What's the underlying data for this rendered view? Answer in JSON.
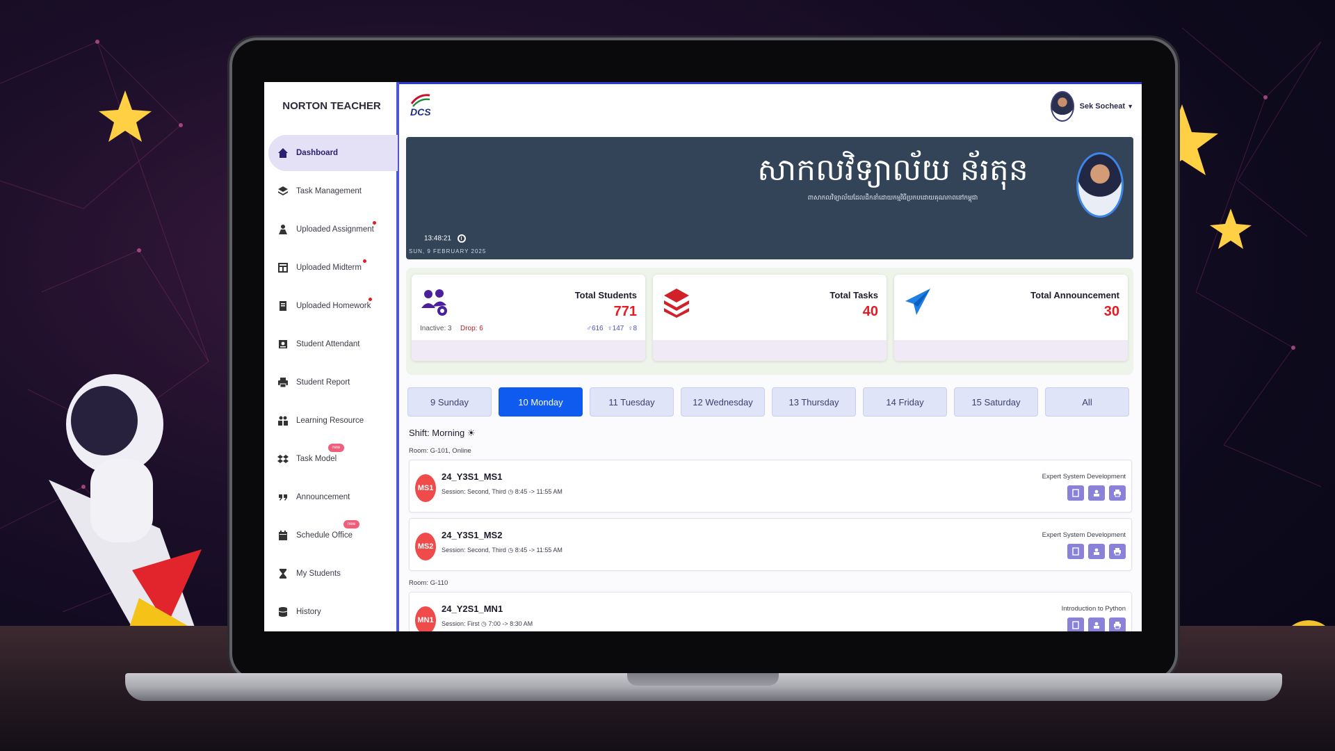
{
  "sidebar": {
    "brand": "NORTON TEACHER",
    "items": [
      {
        "label": "Dashboard"
      },
      {
        "label": "Task Management"
      },
      {
        "label": "Uploaded Assignment"
      },
      {
        "label": "Uploaded Midterm"
      },
      {
        "label": "Uploaded Homework"
      },
      {
        "label": "Student Attendant"
      },
      {
        "label": "Student Report"
      },
      {
        "label": "Learning Resource"
      },
      {
        "label": "Task Model"
      },
      {
        "label": "Announcement"
      },
      {
        "label": "Schedule Office"
      },
      {
        "label": "My Students"
      },
      {
        "label": "History"
      }
    ],
    "new_badge": "new"
  },
  "topbar": {
    "logo_text": "DCS",
    "user_name": "Sek Socheat"
  },
  "banner": {
    "title": "សាកលវិទ្យាល័យ ន័រតុន",
    "subtitle": "ពាសាកលវិទ្យាល័យដែលដឹកនាំដោយកម្មវិធីប្រកបដោយគុណភាពនៅកម្ពុជា",
    "time": "13:48:21",
    "date": "SUN, 9 FEBRUARY 2025"
  },
  "stats": {
    "students": {
      "label": "Total Students",
      "value": "771",
      "inactive": "Inactive: 3",
      "drop": "Drop: 6",
      "male": "♂616",
      "female": "♀147",
      "other": "♀8"
    },
    "tasks": {
      "label": "Total Tasks",
      "value": "40"
    },
    "announcements": {
      "label": "Total Announcement",
      "value": "30"
    }
  },
  "days": [
    {
      "label": "9 Sunday"
    },
    {
      "label": "10 Monday"
    },
    {
      "label": "11 Tuesday"
    },
    {
      "label": "12 Wednesday"
    },
    {
      "label": "13 Thursday"
    },
    {
      "label": "14 Friday"
    },
    {
      "label": "15 Saturday"
    },
    {
      "label": "All"
    }
  ],
  "schedule": {
    "shift": "Shift: Morning ☀",
    "rooms": [
      {
        "room": "Room: G-101, Online",
        "classes": [
          {
            "avatar": "MS1",
            "code": "24_Y3S1_MS1",
            "session": "Session: Second, Third  ◷ 8:45 -> 11:55 AM",
            "subject": "Expert System Development"
          },
          {
            "avatar": "MS2",
            "code": "24_Y3S1_MS2",
            "session": "Session: Second, Third  ◷ 8:45 -> 11:55 AM",
            "subject": "Expert System Development"
          }
        ]
      },
      {
        "room": "Room: G-110",
        "classes": [
          {
            "avatar": "MN1",
            "code": "24_Y2S1_MN1",
            "session": "Session: First  ◷ 7:00 -> 8:30 AM",
            "subject": "Introduction to Python"
          }
        ]
      }
    ]
  },
  "colors": {
    "accent": "#0f5bf0",
    "sidebar_active": "#e4e1f7",
    "banner": "#334459",
    "stat_value": "#e31b23"
  }
}
